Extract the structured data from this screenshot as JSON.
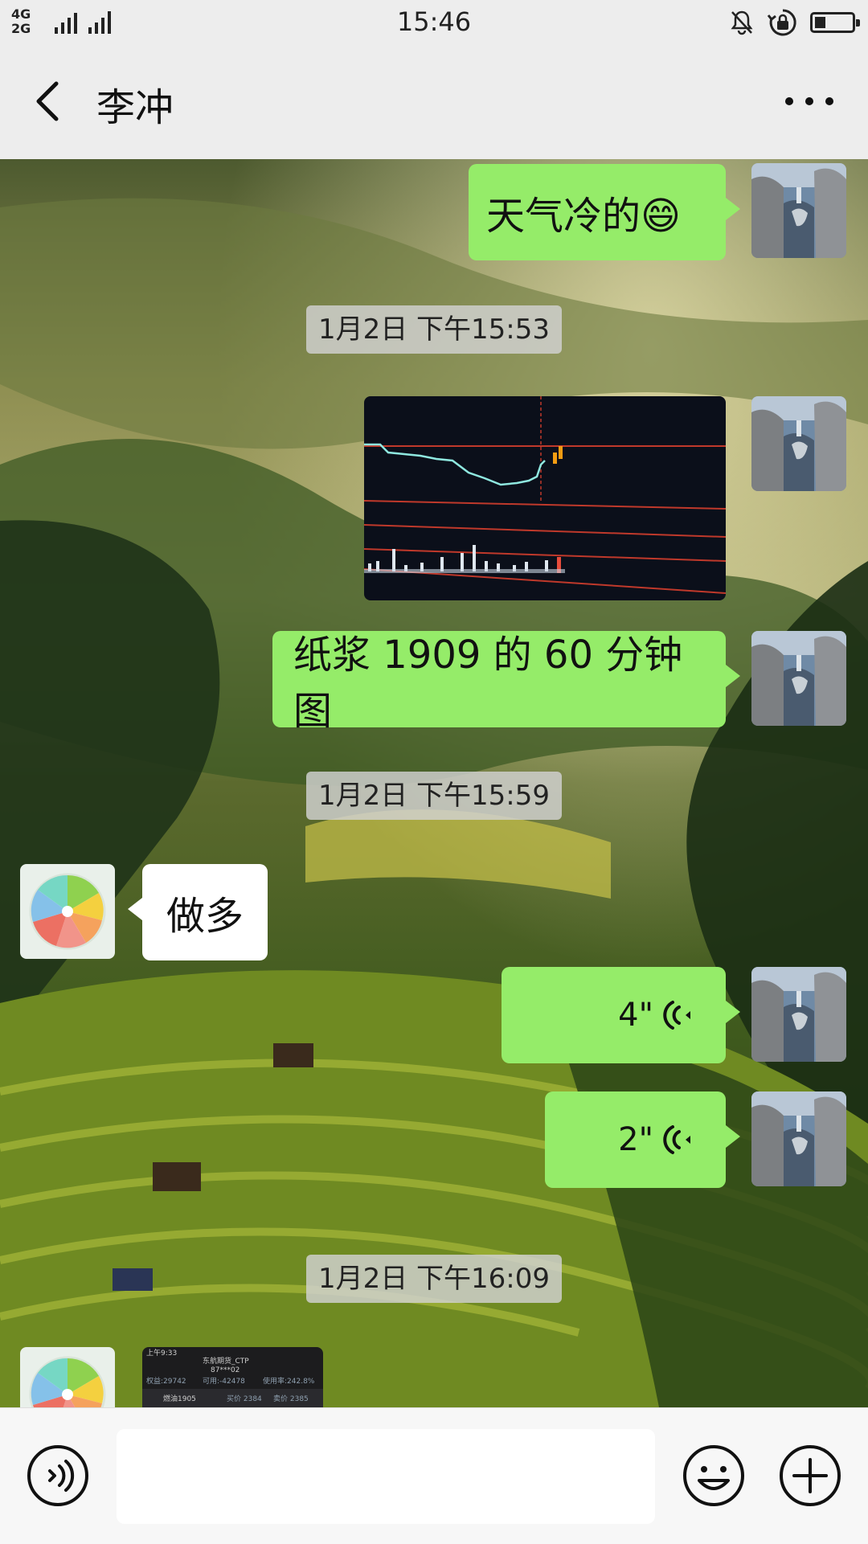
{
  "status_bar": {
    "network_top": "4G",
    "network_bottom": "2G",
    "network_second": "2G",
    "time": "15:46",
    "battery_level": 0.3
  },
  "header": {
    "title": "李冲",
    "back_icon": "chevron-left-icon",
    "more_icon": "more-dots-icon"
  },
  "messages": [
    {
      "type": "text",
      "direction": "out",
      "text": "天气冷的😄"
    },
    {
      "type": "timestamp",
      "text": "1月2日 下午15:53"
    },
    {
      "type": "image",
      "direction": "out",
      "description": ""
    },
    {
      "type": "text",
      "direction": "out",
      "text": "纸浆 1909 的 60 分钟图"
    },
    {
      "type": "timestamp",
      "text": "1月2日 下午15:59"
    },
    {
      "type": "text",
      "direction": "in",
      "text": "做多"
    },
    {
      "type": "voice",
      "direction": "out",
      "duration": "4\""
    },
    {
      "type": "voice",
      "direction": "out",
      "duration": "2\""
    },
    {
      "type": "timestamp",
      "text": "1月2日 下午16:09"
    },
    {
      "type": "image",
      "direction": "in",
      "description": ""
    }
  ],
  "partial_screenshot": {
    "time": "上午9:33",
    "broker": "东航期货_CTP",
    "account": "87***02",
    "equity": "权益:29742",
    "available": "可用:-42478",
    "usage": "使用率:242.8%",
    "contract": "燃油1905",
    "bid": "买价 2384",
    "ask": "卖价 2385"
  },
  "input_bar": {
    "placeholder": "",
    "voice_icon": "voice-input-icon",
    "emoji_icon": "emoji-icon",
    "plus_icon": "plus-icon"
  }
}
